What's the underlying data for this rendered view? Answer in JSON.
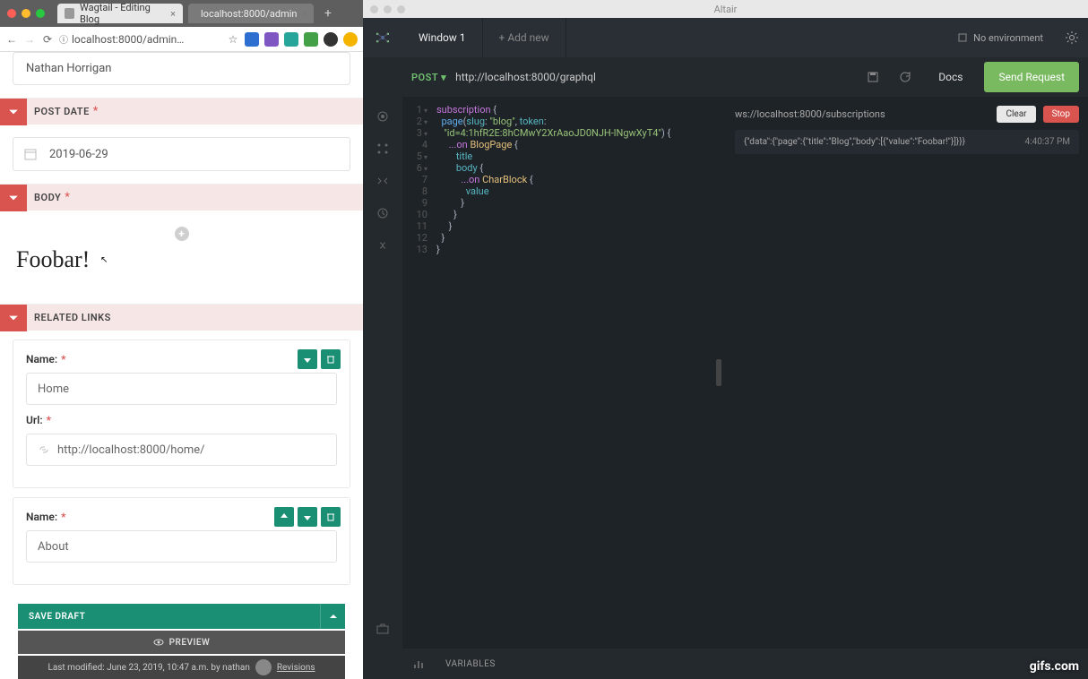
{
  "browser": {
    "tabs": [
      {
        "title": "Wagtail - Editing Blog",
        "active": true
      },
      {
        "title": "localhost:8000/admin",
        "active": false
      }
    ],
    "url": "localhost:8000/admin…"
  },
  "wagtail": {
    "author": "Nathan Horrigan",
    "sections": {
      "post_date": {
        "label": "POST DATE",
        "value": "2019-06-29"
      },
      "body": {
        "label": "BODY",
        "value": "Foobar!"
      },
      "related_links": {
        "label": "RELATED LINKS"
      }
    },
    "links": [
      {
        "name_label": "Name:",
        "name": "Home",
        "url_label": "Url:",
        "url": "http://localhost:8000/home/",
        "has_up": false
      },
      {
        "name_label": "Name:",
        "name": "About",
        "has_up": true
      }
    ],
    "footer": {
      "save": "SAVE DRAFT",
      "preview": "PREVIEW",
      "meta": "Last modified: June 23, 2019, 10:47 a.m. by nathan",
      "revisions": "Revisions"
    }
  },
  "altair": {
    "app_title": "Altair",
    "tabs": {
      "active": "Window 1",
      "add": "+ Add new"
    },
    "env": "No environment",
    "method": "POST ▾",
    "url": "http://localhost:8000/graphql",
    "docs": "Docs",
    "send": "Send Request",
    "query_lines": [
      {
        "n": "1",
        "fold": true,
        "html": "<span class='kw'>subscription</span> <span class='p'>{</span>"
      },
      {
        "n": "2",
        "fold": true,
        "html": "  <span class='fn'>page</span><span class='p'>(</span><span class='fld'>slug</span><span class='p'>:</span> <span class='str'>\"blog\"</span><span class='p'>,</span> <span class='fld'>token</span><span class='p'>:</span>"
      },
      {
        "n": "3",
        "fold": true,
        "html": "   <span class='str'>\"id=4:1hfR2E:8hCMwY2XrAaoJD0NJH-lNgwXyT4\"</span><span class='p'>) {</span>"
      },
      {
        "n": "4",
        "fold": false,
        "html": "     <span class='kw'>...on</span> <span class='typ'>BlogPage</span> <span class='p'>{</span>"
      },
      {
        "n": "5",
        "fold": true,
        "html": "        <span class='fld'>title</span>"
      },
      {
        "n": "6",
        "fold": true,
        "html": "        <span class='fld'>body</span> <span class='p'>{</span>"
      },
      {
        "n": "7",
        "fold": false,
        "html": "          <span class='kw'>...on</span> <span class='typ'>CharBlock</span> <span class='p'>{</span>"
      },
      {
        "n": "8",
        "fold": false,
        "html": "            <span class='fld'>value</span>"
      },
      {
        "n": "9",
        "fold": false,
        "html": "          <span class='p'>}</span>"
      },
      {
        "n": "10",
        "fold": false,
        "html": "       <span class='p'>}</span>"
      },
      {
        "n": "11",
        "fold": false,
        "html": "     <span class='p'>}</span>"
      },
      {
        "n": "12",
        "fold": false,
        "html": "  <span class='p'>}</span>"
      },
      {
        "n": "13",
        "fold": false,
        "html": "<span class='p'>}</span>"
      }
    ],
    "results": {
      "ws": "ws://localhost:8000/subscriptions",
      "clear": "Clear",
      "stop": "Stop",
      "json": "{\"data\":{\"page\":{\"title\":\"Blog\",\"body\":[{\"value\":\"Foobar!\"}]}}}",
      "time": "4:40:37 PM"
    },
    "variables": "VARIABLES"
  },
  "watermark": "gifs.com"
}
